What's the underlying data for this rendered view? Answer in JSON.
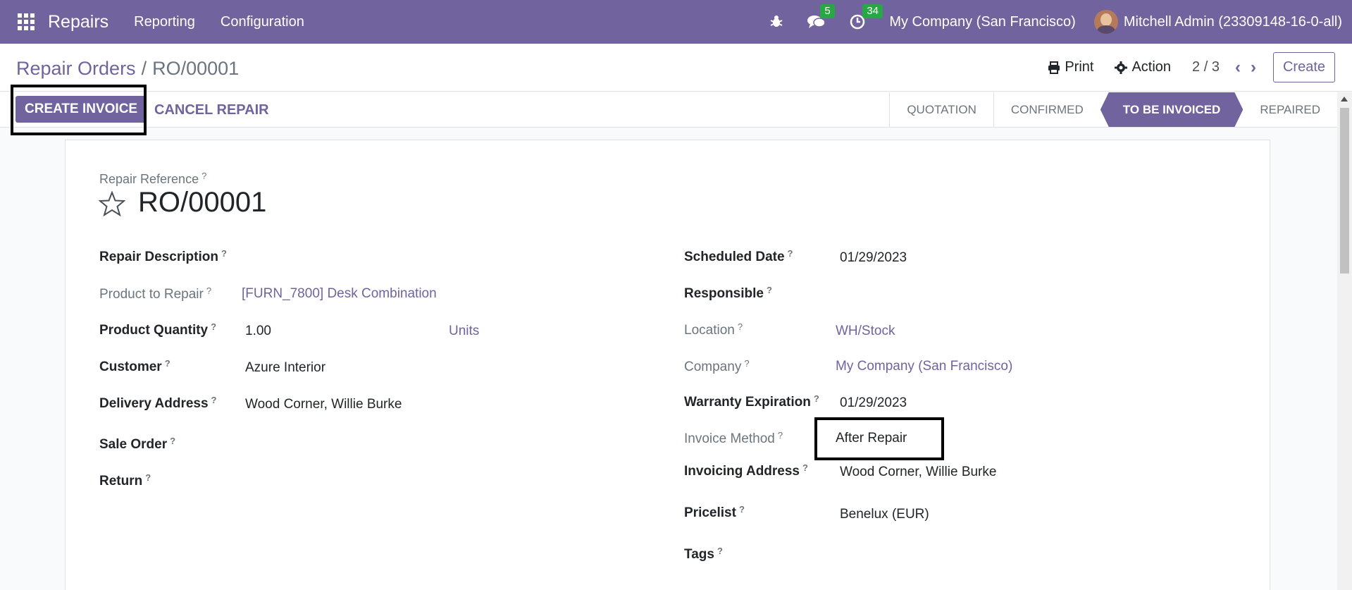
{
  "navbar": {
    "app_name": "Repairs",
    "menu": [
      "Reporting",
      "Configuration"
    ],
    "messages_count": "5",
    "activities_count": "34",
    "company": "My Company (San Francisco)",
    "user": "Mitchell Admin (23309148-16-0-all)"
  },
  "control": {
    "breadcrumb_parent": "Repair Orders",
    "breadcrumb_current": "RO/00001",
    "print": "Print",
    "action": "Action",
    "pager": "2 / 3",
    "create": "Create"
  },
  "statusbar": {
    "create_invoice": "CREATE INVOICE",
    "cancel_repair": "CANCEL REPAIR",
    "stages": [
      "QUOTATION",
      "CONFIRMED",
      "TO BE INVOICED",
      "REPAIRED"
    ],
    "active_stage": "TO BE INVOICED"
  },
  "form": {
    "ref_label": "Repair Reference",
    "ref_value": "RO/00001",
    "left": {
      "repair_description": "Repair Description",
      "product_to_repair_label": "Product to Repair",
      "product_to_repair_value": "[FURN_7800] Desk Combination",
      "product_quantity_label": "Product Quantity",
      "product_quantity_value": "1.00",
      "product_quantity_uom": "Units",
      "customer_label": "Customer",
      "customer_value": "Azure Interior",
      "delivery_address_label": "Delivery Address",
      "delivery_address_value": "Wood Corner, Willie Burke",
      "sale_order_label": "Sale Order",
      "return_label": "Return"
    },
    "right": {
      "scheduled_date_label": "Scheduled Date",
      "scheduled_date_value": "01/29/2023",
      "responsible_label": "Responsible",
      "location_label": "Location",
      "location_value": "WH/Stock",
      "company_label": "Company",
      "company_value": "My Company (San Francisco)",
      "warranty_label": "Warranty Expiration",
      "warranty_value": "01/29/2023",
      "invoice_method_label": "Invoice Method",
      "invoice_method_value": "After Repair",
      "invoicing_address_label": "Invoicing Address",
      "invoicing_address_value": "Wood Corner, Willie Burke",
      "pricelist_label": "Pricelist",
      "pricelist_value": "Benelux (EUR)",
      "tags_label": "Tags"
    },
    "help_mark": "?"
  }
}
